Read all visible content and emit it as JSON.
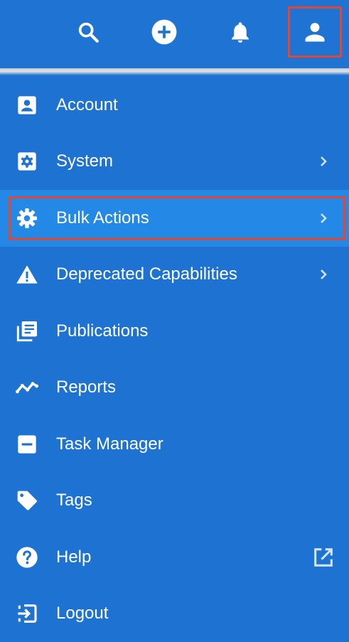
{
  "header": {
    "buttons": [
      {
        "name": "search-button",
        "icon": "search-icon"
      },
      {
        "name": "add-button",
        "icon": "plus-circle-icon"
      },
      {
        "name": "notifications-button",
        "icon": "bell-icon"
      },
      {
        "name": "user-menu-button",
        "icon": "user-icon"
      }
    ]
  },
  "menu": {
    "items": [
      {
        "label": "Account",
        "icon": "account-box-icon",
        "trailing": null
      },
      {
        "label": "System",
        "icon": "settings-box-icon",
        "trailing": "chevron-right-icon"
      },
      {
        "label": "Bulk Actions",
        "icon": "gear-icon",
        "trailing": "chevron-right-icon",
        "active": true
      },
      {
        "label": "Deprecated Capabilities",
        "icon": "warning-icon",
        "trailing": "chevron-right-icon"
      },
      {
        "label": "Publications",
        "icon": "library-books-icon",
        "trailing": null
      },
      {
        "label": "Reports",
        "icon": "trending-line-icon",
        "trailing": null
      },
      {
        "label": "Task Manager",
        "icon": "minus-box-icon",
        "trailing": null
      },
      {
        "label": "Tags",
        "icon": "tag-icon",
        "trailing": null
      },
      {
        "label": "Help",
        "icon": "help-circle-icon",
        "trailing": "external-link-icon"
      },
      {
        "label": "Logout",
        "icon": "logout-icon",
        "trailing": null
      }
    ]
  },
  "colors": {
    "background": "#1e73d2",
    "active_item": "#2388e6",
    "highlight_border": "#e4462f",
    "icon_trailing": "#cfe3fb"
  }
}
